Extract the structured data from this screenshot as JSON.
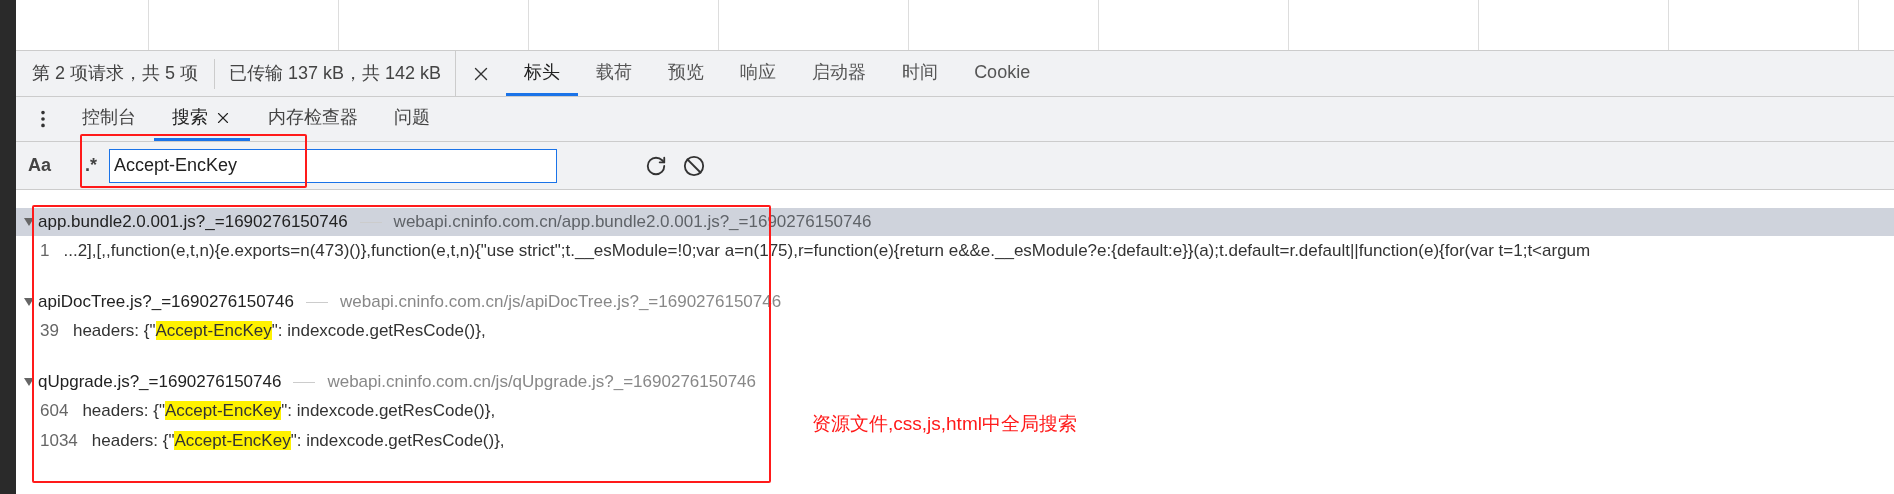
{
  "status_bar": {
    "request_count": "第 2 项请求，共 5 项",
    "transferred": "已传输 137 kB，共 142 kB"
  },
  "detail_tabs": [
    {
      "label": "标头",
      "selected": true
    },
    {
      "label": "载荷",
      "selected": false
    },
    {
      "label": "预览",
      "selected": false
    },
    {
      "label": "响应",
      "selected": false
    },
    {
      "label": "启动器",
      "selected": false
    },
    {
      "label": "时间",
      "selected": false
    },
    {
      "label": "Cookie",
      "selected": false
    }
  ],
  "drawer_tabs": [
    {
      "label": "控制台",
      "selected": false,
      "closable": false
    },
    {
      "label": "搜索",
      "selected": true,
      "closable": true
    },
    {
      "label": "内存检查器",
      "selected": false,
      "closable": false
    },
    {
      "label": "问题",
      "selected": false,
      "closable": false
    }
  ],
  "search": {
    "match_case": "Aa",
    "regex": ".*",
    "value": "Accept-EncKey"
  },
  "results": [
    {
      "file": "app.bundle2.0.001.js?_=1690276150746",
      "url": "webapi.cninfo.com.cn/app.bundle2.0.001.js?_=1690276150746",
      "selected": true,
      "matches": [
        {
          "line": "1",
          "segments": [
            {
              "text": "...2],[,,function(e,t,n){e.exports=n(473)()},function(e,t,n){\"use strict\";t.__esModule=!0;var a=n(175),r=function(e){return e&&e.__esModule?e:{default:e}}(a);t.default=r.default||function(e){for(var t=1;t<argum",
              "highlight": false
            }
          ]
        }
      ]
    },
    {
      "file": "apiDocTree.js?_=1690276150746",
      "url": "webapi.cninfo.com.cn/js/apiDocTree.js?_=1690276150746",
      "selected": false,
      "matches": [
        {
          "line": "39",
          "segments": [
            {
              "text": "headers: {\"",
              "highlight": false
            },
            {
              "text": "Accept-EncKey",
              "highlight": true
            },
            {
              "text": "\": indexcode.getResCode()},",
              "highlight": false
            }
          ]
        }
      ]
    },
    {
      "file": "qUpgrade.js?_=1690276150746",
      "url": "webapi.cninfo.com.cn/js/qUpgrade.js?_=1690276150746",
      "selected": false,
      "matches": [
        {
          "line": "604",
          "segments": [
            {
              "text": "headers: {\"",
              "highlight": false
            },
            {
              "text": "Accept-EncKey",
              "highlight": true
            },
            {
              "text": "\": indexcode.getResCode()},",
              "highlight": false
            }
          ]
        },
        {
          "line": "1034",
          "segments": [
            {
              "text": "headers: {\"",
              "highlight": false
            },
            {
              "text": "Accept-EncKey",
              "highlight": true
            },
            {
              "text": "\": indexcode.getResCode()},",
              "highlight": false
            }
          ]
        }
      ]
    }
  ],
  "annotation": {
    "text": "资源文件,css,js,html中全局搜索"
  }
}
